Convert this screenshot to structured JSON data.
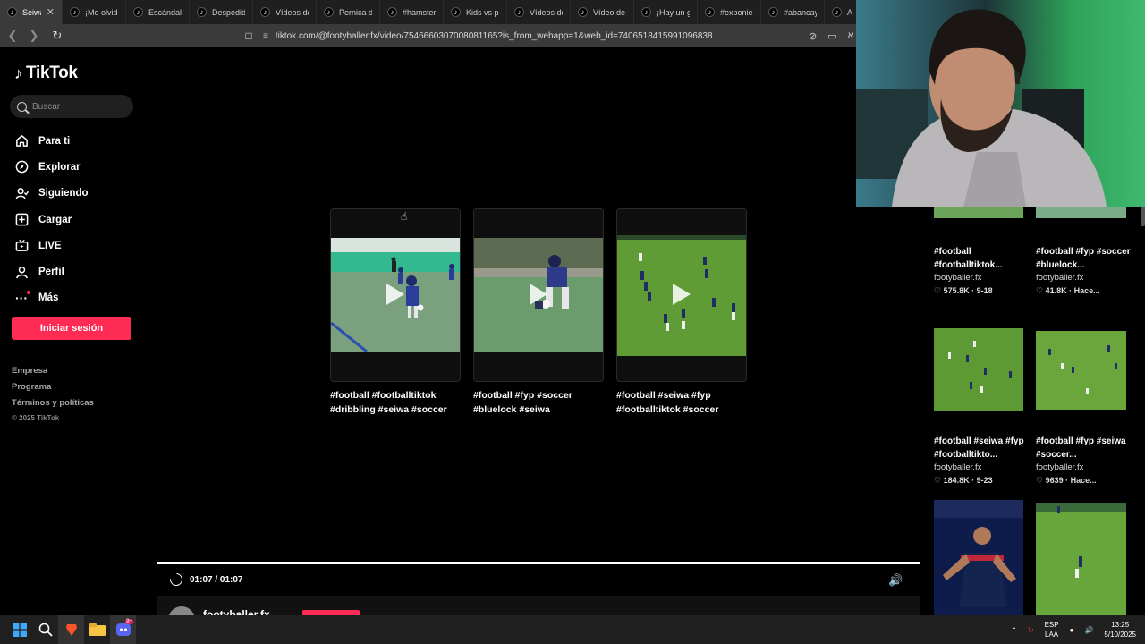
{
  "browser": {
    "tabs": [
      {
        "label": "Seiwa",
        "active": true
      },
      {
        "label": "¡Me olvide"
      },
      {
        "label": "Escándalo"
      },
      {
        "label": "Despedida"
      },
      {
        "label": "Vídeos de"
      },
      {
        "label": "Pernica de"
      },
      {
        "label": "#hamster"
      },
      {
        "label": "Kids vs par"
      },
      {
        "label": "Vídeos de"
      },
      {
        "label": "Vídeo de d"
      },
      {
        "label": "¡Hay un go"
      },
      {
        "label": "#exponien"
      },
      {
        "label": "#abancay"
      },
      {
        "label": "A"
      }
    ],
    "close_glyph": "✕",
    "url": "tiktok.com/@footyballer.fx/video/7546660307008081165?is_from_webapp=1&web_id=7406518415991096838"
  },
  "sidebar": {
    "logo_text": "TikTok",
    "search_placeholder": "Buscar",
    "nav": [
      {
        "label": "Para ti",
        "icon": "home-icon"
      },
      {
        "label": "Explorar",
        "icon": "compass-icon"
      },
      {
        "label": "Siguiendo",
        "icon": "following-icon"
      },
      {
        "label": "Cargar",
        "icon": "upload-icon"
      },
      {
        "label": "LIVE",
        "icon": "live-icon"
      },
      {
        "label": "Perfil",
        "icon": "profile-icon"
      },
      {
        "label": "Más",
        "icon": "more-icon"
      }
    ],
    "login_label": "Iniciar sesión",
    "footer": [
      "Empresa",
      "Programa",
      "Términos y políticas"
    ],
    "copyright": "© 2025 TikTok"
  },
  "player": {
    "recommended": [
      {
        "caption": "#football #footballtiktok #dribbling #seiwa #soccer"
      },
      {
        "caption": "#football #fyp #soccer #bluelock #seiwa"
      },
      {
        "caption": "#football #seiwa #fyp #footballtiktok #soccer"
      }
    ],
    "time": "01:07 / 01:07",
    "progress": 1.0,
    "author": "footyballer.fx"
  },
  "right_column": {
    "items": [
      {
        "title": "#football #footballtiktok...",
        "author": "footyballer.fx",
        "stats": "♡ 575.8K · 9-18"
      },
      {
        "title": "#football #fyp #soccer #bluelock...",
        "author": "footyballer.fx",
        "stats": "♡ 41.8K · Hace..."
      },
      {
        "title": "#football #seiwa #fyp #footballtikto...",
        "author": "footyballer.fx",
        "stats": "♡ 184.8K · 9-23"
      },
      {
        "title": "#football #fyp #seiwa #soccer...",
        "author": "footyballer.fx",
        "stats": "♡ 9639 · Hace..."
      }
    ]
  },
  "taskbar": {
    "lang_line1": "ESP",
    "lang_line2": "LAA",
    "time": "13:25",
    "date": "5/10/2025",
    "discord_badge": "9+"
  },
  "colors": {
    "accent": "#fe2c55",
    "pitch_green": "#5c9c33",
    "background": "#000000"
  }
}
